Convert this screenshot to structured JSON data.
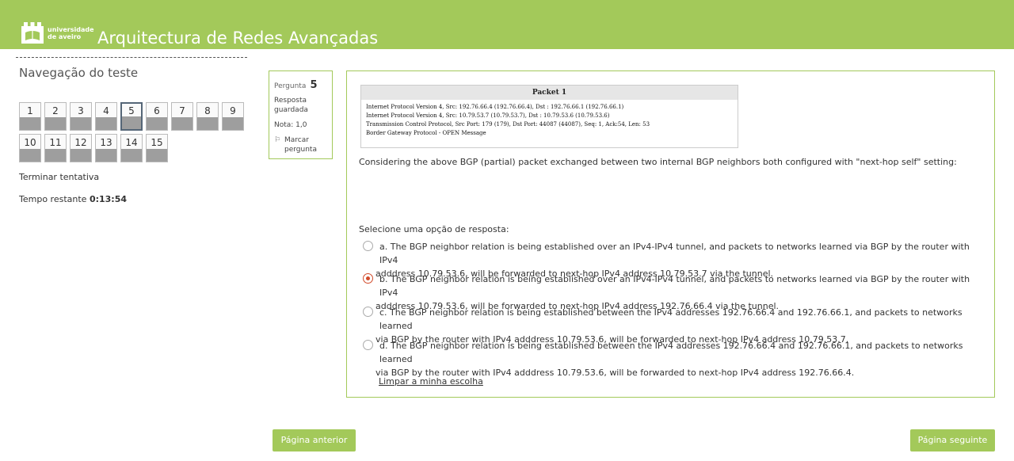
{
  "header": {
    "logo_text_line1": "universidade",
    "logo_text_line2": "de aveiro",
    "title": "Arquitectura de Redes Avançadas",
    "bg_color": "#a3c95a"
  },
  "navigation": {
    "title": "Navegação do teste",
    "questions": [
      "1",
      "2",
      "3",
      "4",
      "5",
      "6",
      "7",
      "8",
      "9",
      "10",
      "11",
      "12",
      "13",
      "14",
      "15"
    ],
    "current": "5",
    "finish_label": "Terminar tentativa",
    "timer_label": "Tempo restante",
    "timer_value": "0:13:54"
  },
  "question_info": {
    "label": "Pergunta",
    "number": "5",
    "state_line1": "Resposta",
    "state_line2": "guardada",
    "grade": "Nota: 1,0",
    "flag_line1": "Marcar",
    "flag_line2": "pergunta",
    "flag_icon": "flag-icon"
  },
  "question": {
    "packet_title": "Packet 1",
    "packet_lines": [
      "Internet Protocol Version 4, Src: 192.76.66.4 (192.76.66.4), Dst : 192.76.66.1 (192.76.66.1)",
      "Internet Protocol Version 4, Src: 10.79.53.7 (10.79.53.7), Dst : 10.79.53.6 (10.79.53.6)",
      "Transmission Control Protocol, Src Port: 179 (179), Dst Port: 44087 (44087), Seq: 1, Ack:54, Len: 53",
      "Border Gateway Protocol - OPEN Message"
    ],
    "text": "Considering the above BGP (partial) packet exchanged between two internal BGP neighbors both configured with \"next-hop self\" setting:",
    "prompt": "Selecione uma opção de resposta:",
    "options": [
      {
        "line1": "a. The BGP neighbor relation is being established over an IPv4-IPv4 tunnel, and packets to networks learned via BGP by the router with IPv4",
        "line2": "adddress 10.79.53.6, will be forwarded to next-hop IPv4 address 10.79.53.7 via the tunnel.",
        "checked": false
      },
      {
        "line1": "b. The BGP neighbor relation is being established over an IPv4-IPv4 tunnel, and packets to networks learned via BGP by the router with IPv4",
        "line2": "adddress 10.79.53.6, will be forwarded to next-hop IPv4 address 192.76.66.4 via the tunnel.",
        "checked": true
      },
      {
        "line1": "c. The BGP neighbor relation is being established between the IPv4 addresses 192.76.66.4 and 192.76.66.1, and packets to networks learned",
        "line2": "via BGP by the router with IPv4 adddress 10.79.53.6, will be forwarded to next-hop IPv4 address 10.79.53.7.",
        "checked": false
      },
      {
        "line1": "d. The BGP neighbor relation is being established between the IPv4 addresses 192.76.66.4 and 192.76.66.1, and packets to networks learned",
        "line2": "via BGP by the router with IPv4 adddress 10.79.53.6, will be forwarded to next-hop IPv4 address 192.76.66.4.",
        "checked": false
      }
    ],
    "clear_label": "Limpar a minha escolha"
  },
  "footer": {
    "prev_label": "Página anterior",
    "next_label": "Página seguinte"
  }
}
